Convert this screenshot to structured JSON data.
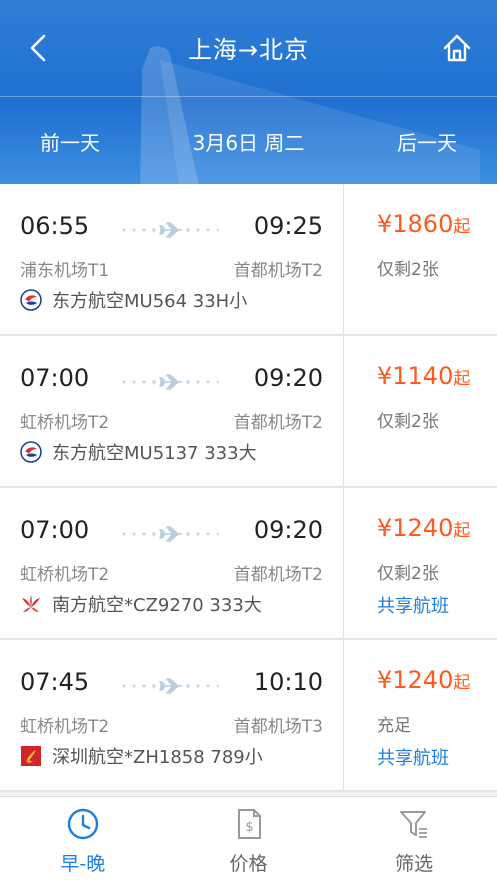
{
  "header": {
    "route_title": "上海→北京",
    "prev_day": "前一天",
    "current_date": "3月6日 周二",
    "next_day": "后一天"
  },
  "flights": [
    {
      "dep_time": "06:55",
      "arr_time": "09:25",
      "dep_airport": "浦东机场T1",
      "arr_airport": "首都机场T2",
      "airline": "东方航空MU564 33H小",
      "airline_logo": "china-eastern-logo-icon",
      "price": "¥1860",
      "price_unit": "起",
      "seats": "仅剩2张",
      "share": ""
    },
    {
      "dep_time": "07:00",
      "arr_time": "09:20",
      "dep_airport": "虹桥机场T2",
      "arr_airport": "首都机场T2",
      "airline": "东方航空MU5137 333大",
      "airline_logo": "china-eastern-logo-icon",
      "price": "¥1140",
      "price_unit": "起",
      "seats": "仅剩2张",
      "share": ""
    },
    {
      "dep_time": "07:00",
      "arr_time": "09:20",
      "dep_airport": "虹桥机场T2",
      "arr_airport": "首都机场T2",
      "airline": "南方航空*CZ9270 333大",
      "airline_logo": "china-southern-logo-icon",
      "price": "¥1240",
      "price_unit": "起",
      "seats": "仅剩2张",
      "share": "共享航班"
    },
    {
      "dep_time": "07:45",
      "arr_time": "10:10",
      "dep_airport": "虹桥机场T2",
      "arr_airport": "首都机场T3",
      "airline": "深圳航空*ZH1858 789小",
      "airline_logo": "shenzhen-airlines-logo-icon",
      "price": "¥1240",
      "price_unit": "起",
      "seats": "充足",
      "share": "共享航班"
    }
  ],
  "tabs": [
    {
      "label": "早-晚",
      "icon": "clock-icon",
      "active": true
    },
    {
      "label": "价格",
      "icon": "price-doc-icon",
      "active": false
    },
    {
      "label": "筛选",
      "icon": "filter-icon",
      "active": false
    }
  ],
  "colors": {
    "header_blue": "#1f6fd0",
    "price_orange": "#ff5a1f",
    "link_blue": "#1d7fe0"
  }
}
